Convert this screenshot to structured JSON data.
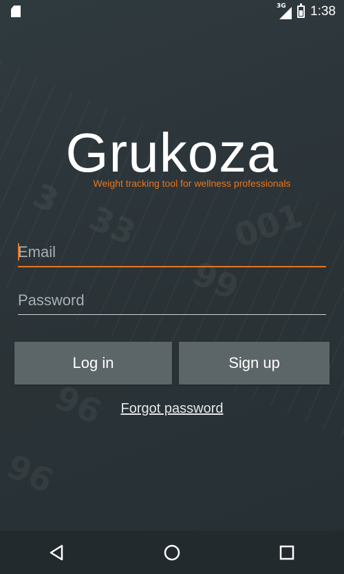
{
  "status_bar": {
    "network_label": "3G",
    "time": "1:38"
  },
  "app": {
    "name": "Grukoza",
    "tagline": "Weight tracking tool for wellness professionals",
    "accent_color": "#e8761f"
  },
  "form": {
    "email_placeholder": "Email",
    "password_placeholder": "Password"
  },
  "buttons": {
    "login_label": "Log in",
    "signup_label": "Sign up"
  },
  "links": {
    "forgot_password": "Forgot password"
  },
  "nav": {
    "icons": [
      "back-icon",
      "home-icon",
      "recents-icon"
    ]
  }
}
